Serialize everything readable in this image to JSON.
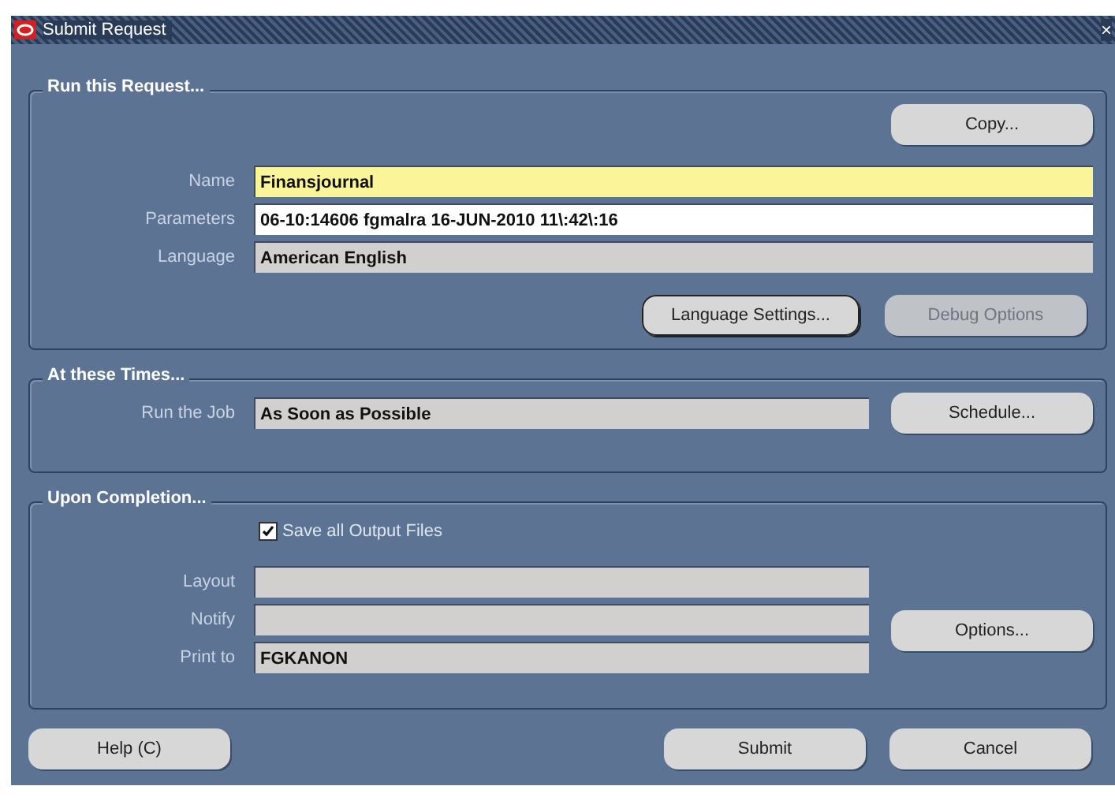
{
  "window": {
    "title": "Submit Request",
    "close": "×"
  },
  "sections": [
    {
      "title": "Run this Request...",
      "top_button": {
        "label": "Copy...",
        "disabled": false
      },
      "fields": [
        {
          "label": "Name",
          "value": "Finansjournal",
          "kind": "focused"
        },
        {
          "label": "Parameters",
          "value": "06-10:14606 fgmalra 16-JUN-2010 11\\:42\\:16",
          "kind": "editable"
        },
        {
          "label": "Language",
          "value": "American English",
          "kind": "readonly"
        }
      ],
      "buttons": [
        {
          "label": "Language Settings...",
          "disabled": false,
          "selected": true
        },
        {
          "label": "Debug Options",
          "disabled": true,
          "selected": false
        }
      ]
    },
    {
      "title": "At these Times...",
      "fields": [
        {
          "label": "Run the Job",
          "value": "As Soon as Possible",
          "kind": "readonly"
        }
      ],
      "side_button": {
        "label": "Schedule...",
        "disabled": false
      }
    },
    {
      "title": "Upon Completion...",
      "checkbox": {
        "label": "Save all Output Files",
        "checked": true
      },
      "fields": [
        {
          "label": "Layout",
          "kind": "readonly"
        },
        {
          "label": "Notify",
          "kind": "readonly"
        },
        {
          "label": "Print to",
          "value": "FGKANON",
          "kind": "readonly"
        }
      ],
      "side_button": {
        "label": "Options...",
        "disabled": false
      }
    }
  ],
  "footer": {
    "left": {
      "label": "Help (C)"
    },
    "right": [
      {
        "label": "Submit"
      },
      {
        "label": "Cancel"
      }
    ]
  }
}
